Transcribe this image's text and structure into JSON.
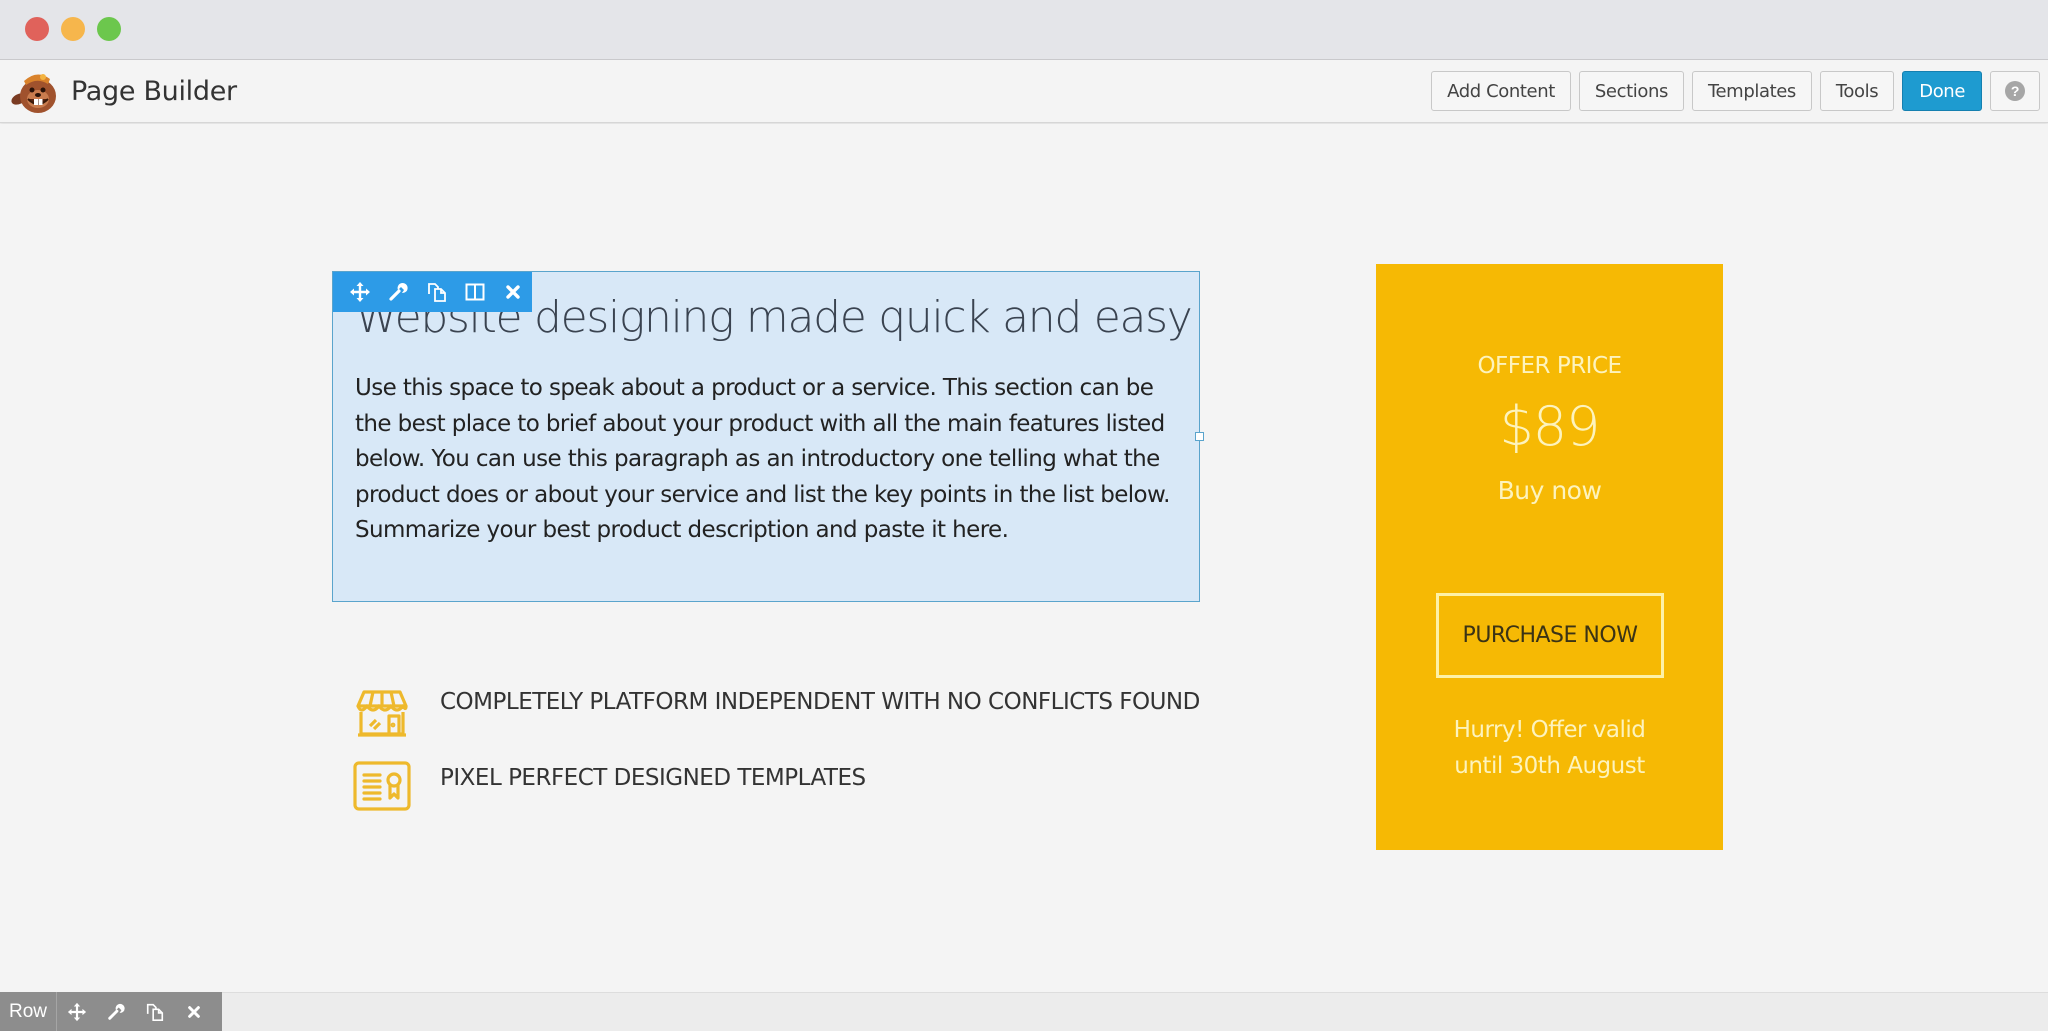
{
  "window": {
    "controls": [
      "close",
      "minimize",
      "maximize"
    ]
  },
  "toolbar": {
    "app_title": "Page Builder",
    "logo_icon": "beaver-mascot-icon",
    "buttons": {
      "add_content": "Add Content",
      "sections": "Sections",
      "templates": "Templates",
      "tools": "Tools",
      "done": "Done",
      "help": "?"
    },
    "accent_color": "#1e9bd0"
  },
  "module": {
    "tools": [
      "move-icon",
      "wrench-icon",
      "duplicate-icon",
      "columns-icon",
      "close-icon"
    ],
    "heading": "Website designing made quick and easy",
    "paragraph": "Use this space to speak about a product or a service. This section can be the best place to brief about your product with all the main features listed below. You can use this paragraph as an introductory one telling what the product does or about your service and list the key points in the list below. Summarize your best product description and paste it here.",
    "highlight_color": "#2d9be7"
  },
  "features": [
    {
      "icon": "storefront-icon",
      "text": "COMPLETELY PLATFORM INDEPENDENT WITH NO CONFLICTS FOUND"
    },
    {
      "icon": "certificate-icon",
      "text": "PIXEL PERFECT DESIGNED TEMPLATES"
    }
  ],
  "pricing": {
    "label": "OFFER PRICE",
    "price": "$89",
    "subtitle": "Buy now",
    "cta": "PURCHASE NOW",
    "note_line1": "Hurry! Offer valid",
    "note_line2": "until 30th August",
    "card_color": "#f6b904"
  },
  "rowbar": {
    "label": "Row",
    "tools": [
      "move-icon",
      "wrench-icon",
      "duplicate-icon",
      "close-icon"
    ]
  }
}
